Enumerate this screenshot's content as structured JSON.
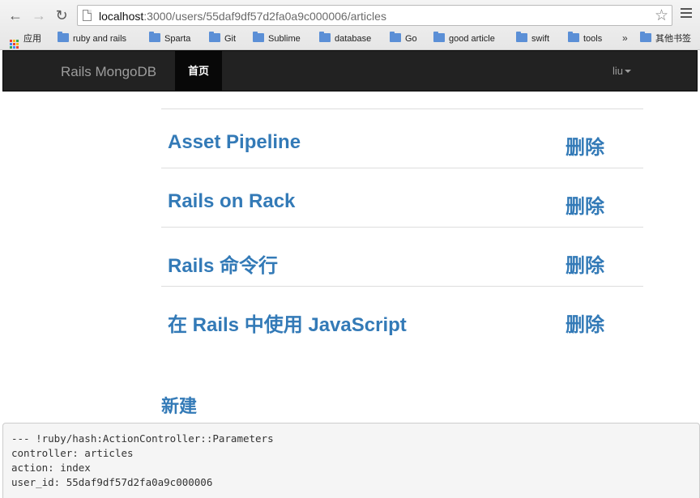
{
  "browser": {
    "url_host": "localhost",
    "url_path": ":3000/users/55daf9df57d2fa0a9c000006/articles",
    "bookmarks": [
      "应用",
      "ruby and rails",
      "Sparta",
      "Git",
      "Sublime",
      "database",
      "Go",
      "good article",
      "swift",
      "tools",
      "其他书签"
    ],
    "overflow": "»"
  },
  "navbar": {
    "brand": "Rails MongoDB",
    "home": "首页",
    "user": "liu"
  },
  "articles": [
    {
      "title": "Asset Pipeline",
      "action": "删除"
    },
    {
      "title": "Rails on Rack",
      "action": "删除"
    },
    {
      "title": "Rails 命令行",
      "action": "删除"
    },
    {
      "title": "在 Rails 中使用 JavaScript",
      "action": "删除"
    }
  ],
  "new_link": "新建",
  "debug": [
    "--- !ruby/hash:ActionController::Parameters",
    "controller: articles",
    "action: index",
    "user_id: 55daf9df57d2fa0a9c000006"
  ],
  "colors": {
    "link": "#337ab7",
    "navbar": "#222222"
  },
  "icons": [
    "back-arrow-icon",
    "forward-arrow-icon",
    "reload-icon",
    "page-icon",
    "star-icon",
    "menu-icon",
    "folder-icon",
    "apps-icon"
  ]
}
